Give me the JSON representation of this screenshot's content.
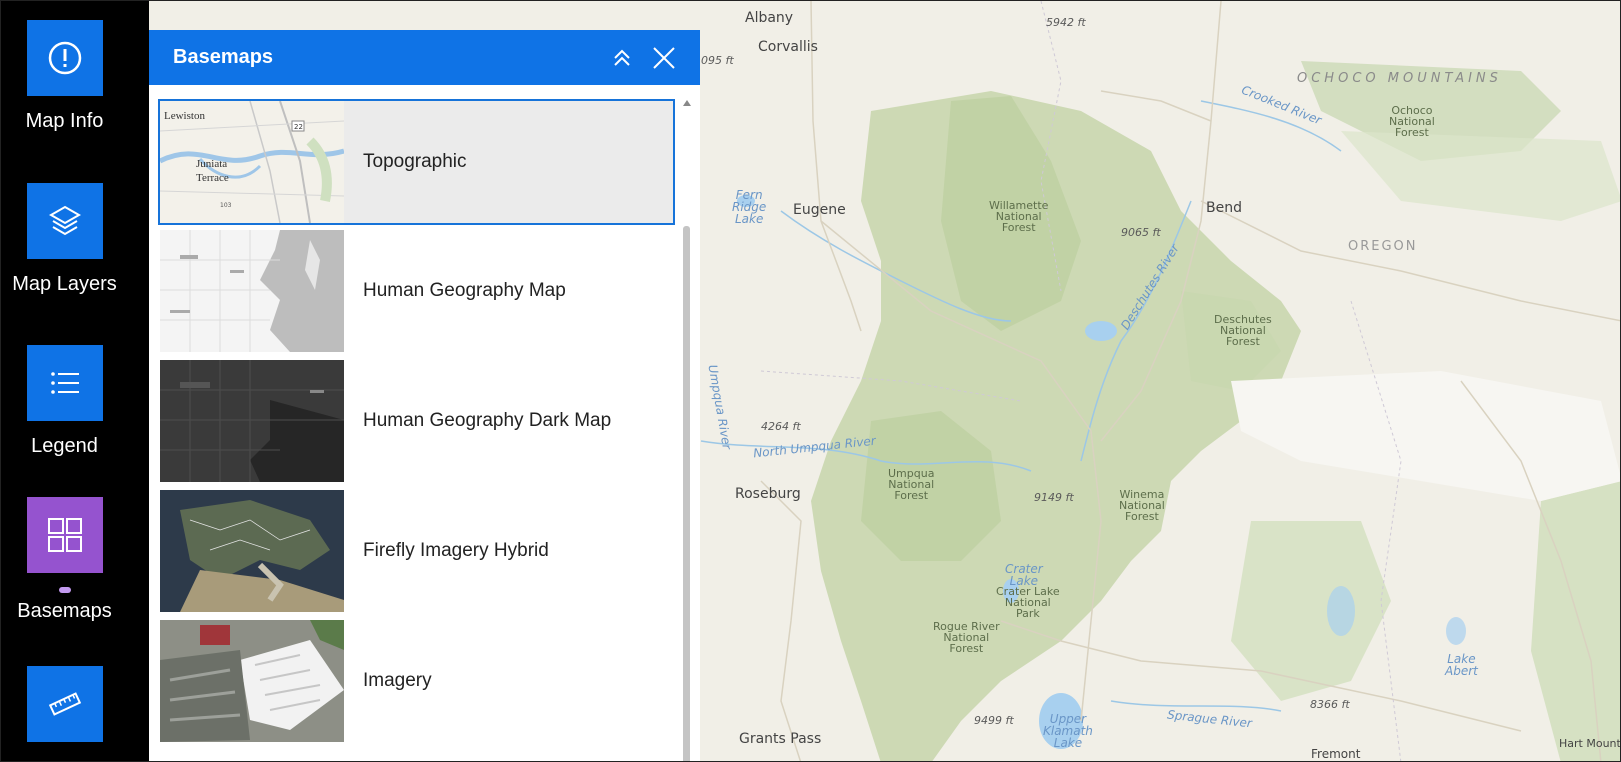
{
  "sidebar": {
    "items": [
      {
        "label": "Map Info",
        "icon": "info-circle-icon",
        "active": false
      },
      {
        "label": "Map Layers",
        "icon": "layers-icon",
        "active": false
      },
      {
        "label": "Legend",
        "icon": "legend-list-icon",
        "active": false
      },
      {
        "label": "Basemaps",
        "icon": "basemap-grid-icon",
        "active": true
      },
      {
        "label": "",
        "icon": "measure-ruler-icon",
        "active": false
      }
    ]
  },
  "panel": {
    "title": "Basemaps",
    "collapse_icon": "chevrons-up-icon",
    "close_icon": "close-icon",
    "basemaps": [
      {
        "label": "Topographic",
        "selected": true
      },
      {
        "label": "Human Geography Map",
        "selected": false
      },
      {
        "label": "Human Geography Dark Map",
        "selected": false
      },
      {
        "label": "Firefly Imagery Hybrid",
        "selected": false
      },
      {
        "label": "Imagery",
        "selected": false
      }
    ]
  },
  "thumbnail_text": {
    "lewiston": "Lewiston",
    "juniata": "Juniata",
    "terrace": "Terrace",
    "route": "22",
    "route2": "103"
  },
  "map": {
    "cities": {
      "albany": "Albany",
      "corvallis": "Corvallis",
      "eugene": "Eugene",
      "bend": "Bend",
      "roseburg": "Roseburg",
      "grants_pass": "Grants Pass",
      "fremont": "Fremont",
      "hart": "Hart Mount"
    },
    "region": "OCHOCO MOUNTAINS",
    "state": "OREGON",
    "forests": {
      "ochoco": "Ochoco\nNational\nForest",
      "willamette": "Willamette\nNational\nForest",
      "deschutes": "Deschutes\nNational\nForest",
      "umpqua": "Umpqua\nNational\nForest",
      "winema": "Winema\nNational\nForest",
      "crater_park": "Crater Lake\nNational\nPark",
      "rogue": "Rogue River\nNational\nForest"
    },
    "water": {
      "fern": "Fern\nRidge\nLake",
      "crooked": "Crooked River",
      "deschutes": "Deschutes River",
      "north_umpqua": "North Umpqua River",
      "crater": "Crater\nLake",
      "klamath": "Upper\nKlamath\nLake",
      "sprague": "Sprague River",
      "abert": "Lake\nAbert",
      "umpqua": "Umpqua River"
    },
    "elevations": {
      "e1": "5942 ft",
      "e2": "9065 ft",
      "e3": "4264 ft",
      "e4": "9149 ft",
      "e5": "9499 ft",
      "e6": "8366 ft",
      "e7": "095 ft"
    },
    "colors": {
      "land": "#f1efe7",
      "forest": "#cdd9b4",
      "forest_dark": "#bcd0a0",
      "water": "#a8d0ef",
      "desert": "#f8f7f4"
    }
  }
}
